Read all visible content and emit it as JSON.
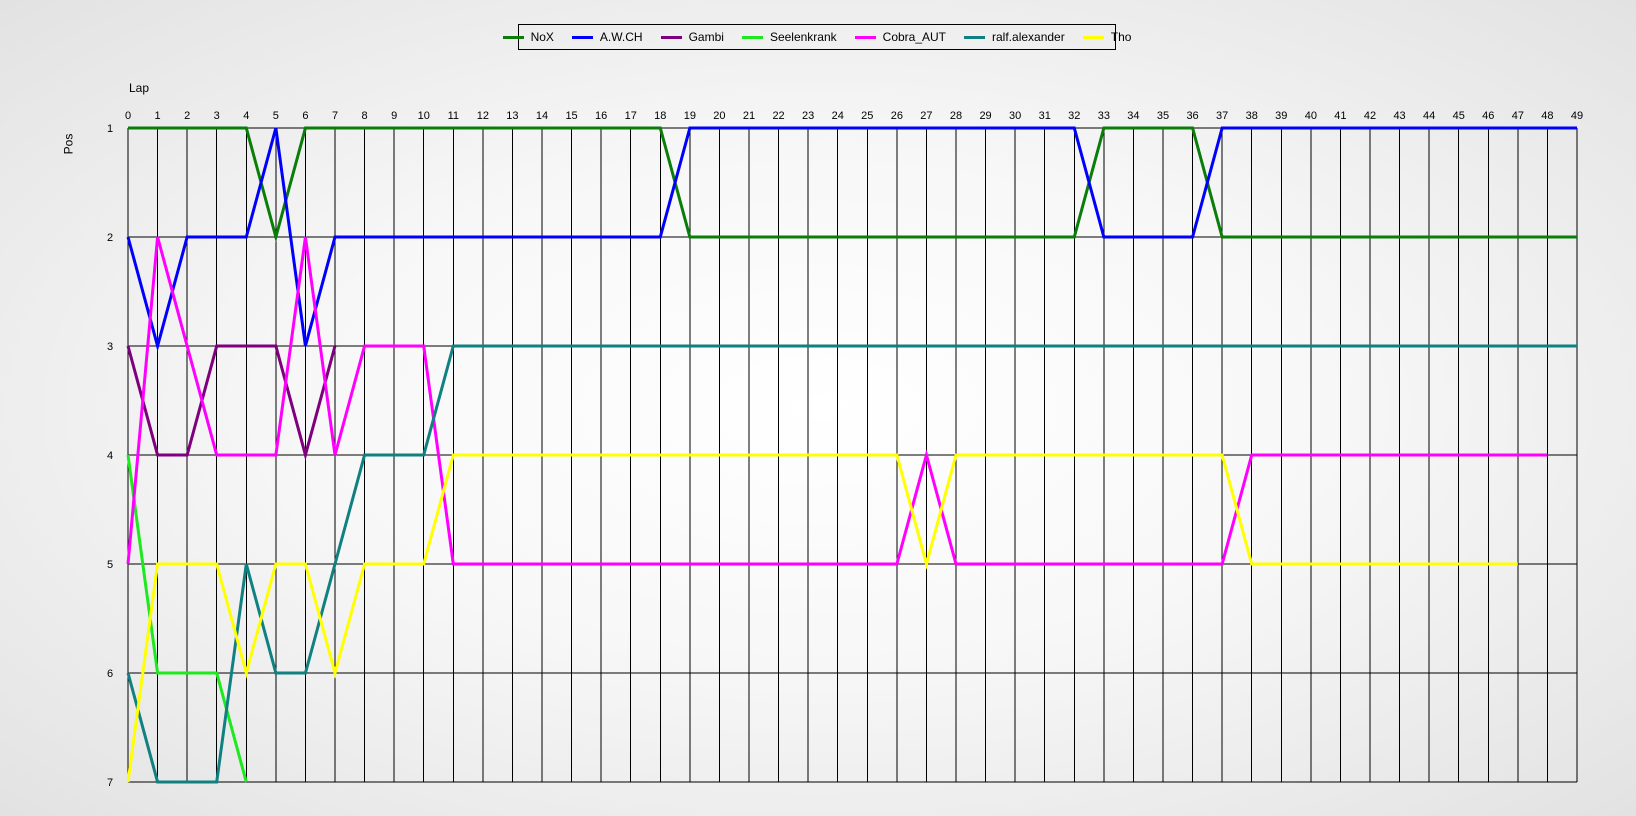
{
  "chart_data": {
    "type": "line",
    "xlabel": "Lap",
    "ylabel": "Pos",
    "xlim": [
      0,
      49
    ],
    "ylim": [
      1,
      7
    ],
    "y_inverted": true,
    "grid": true,
    "legend_position": "top-center",
    "x_ticks": [
      0,
      1,
      2,
      3,
      4,
      5,
      6,
      7,
      8,
      9,
      10,
      11,
      12,
      13,
      14,
      15,
      16,
      17,
      18,
      19,
      20,
      21,
      22,
      23,
      24,
      25,
      26,
      27,
      28,
      29,
      30,
      31,
      32,
      33,
      34,
      35,
      36,
      37,
      38,
      39,
      40,
      41,
      42,
      43,
      44,
      45,
      46,
      47,
      48,
      49
    ],
    "y_ticks": [
      1,
      2,
      3,
      4,
      5,
      6,
      7
    ],
    "series": [
      {
        "name": "NoX",
        "color": "#0a7d0a",
        "points": [
          [
            0,
            1
          ],
          [
            4,
            1
          ],
          [
            5,
            2
          ],
          [
            6,
            1
          ],
          [
            18,
            1
          ],
          [
            19,
            2
          ],
          [
            32,
            2
          ],
          [
            33,
            1
          ],
          [
            36,
            1
          ],
          [
            37,
            2
          ],
          [
            49,
            2
          ]
        ]
      },
      {
        "name": "A.W.CH",
        "color": "#0000ff",
        "points": [
          [
            0,
            2
          ],
          [
            1,
            3
          ],
          [
            2,
            2
          ],
          [
            4,
            2
          ],
          [
            5,
            1
          ],
          [
            6,
            3
          ],
          [
            7,
            2
          ],
          [
            18,
            2
          ],
          [
            19,
            1
          ],
          [
            32,
            1
          ],
          [
            33,
            2
          ],
          [
            36,
            2
          ],
          [
            37,
            1
          ],
          [
            49,
            1
          ]
        ]
      },
      {
        "name": "Gambi",
        "color": "#7f007f",
        "points": [
          [
            0,
            3
          ],
          [
            1,
            4
          ],
          [
            2,
            4
          ],
          [
            3,
            3
          ],
          [
            5,
            3
          ],
          [
            6,
            4
          ],
          [
            7,
            3
          ]
        ]
      },
      {
        "name": "Seelenkrank",
        "color": "#1ee81e",
        "points": [
          [
            0,
            4
          ],
          [
            1,
            6
          ],
          [
            3,
            6
          ],
          [
            4,
            7
          ]
        ]
      },
      {
        "name": "Cobra_AUT",
        "color": "#ff00ff",
        "points": [
          [
            0,
            5
          ],
          [
            1,
            2
          ],
          [
            3,
            4
          ],
          [
            5,
            4
          ],
          [
            6,
            2
          ],
          [
            7,
            4
          ],
          [
            8,
            3
          ],
          [
            10,
            3
          ],
          [
            11,
            5
          ],
          [
            26,
            5
          ],
          [
            27,
            4
          ],
          [
            28,
            5
          ],
          [
            37,
            5
          ],
          [
            38,
            4
          ],
          [
            48,
            4
          ]
        ]
      },
      {
        "name": "ralf.alexander",
        "color": "#108080",
        "points": [
          [
            0,
            6
          ],
          [
            1,
            7
          ],
          [
            3,
            7
          ],
          [
            4,
            5
          ],
          [
            5,
            6
          ],
          [
            6,
            6
          ],
          [
            8,
            4
          ],
          [
            10,
            4
          ],
          [
            11,
            3
          ],
          [
            49,
            3
          ]
        ]
      },
      {
        "name": "Tho",
        "color": "#ffff00",
        "points": [
          [
            0,
            7
          ],
          [
            1,
            5
          ],
          [
            3,
            5
          ],
          [
            4,
            6
          ],
          [
            5,
            5
          ],
          [
            6,
            5
          ],
          [
            7,
            6
          ],
          [
            8,
            5
          ],
          [
            10,
            5
          ],
          [
            11,
            4
          ],
          [
            26,
            4
          ],
          [
            27,
            5
          ],
          [
            28,
            4
          ],
          [
            37,
            4
          ],
          [
            38,
            5
          ],
          [
            47,
            5
          ]
        ]
      }
    ]
  }
}
